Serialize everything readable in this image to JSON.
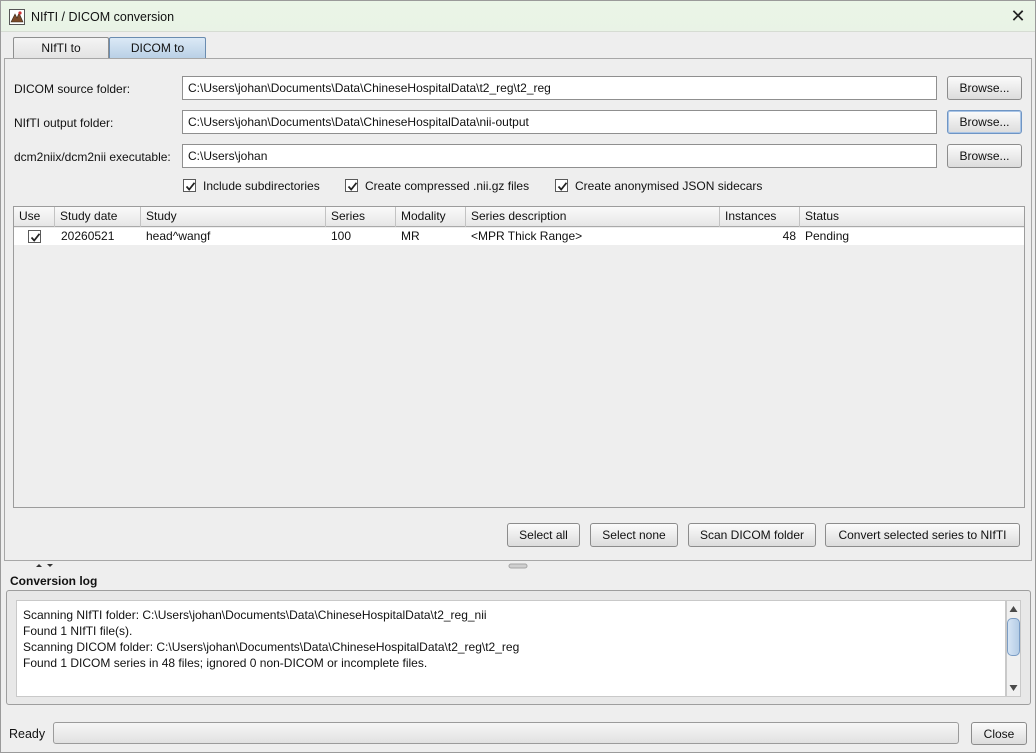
{
  "window": {
    "title": "NIfTI / DICOM conversion",
    "app_icon": "app-logo-icon",
    "close_glyph": "✕"
  },
  "tabs": [
    {
      "label": "NIfTI to DICOM",
      "selected": false
    },
    {
      "label": "DICOM to NIfTI",
      "selected": true
    }
  ],
  "form": {
    "source_label": "DICOM source folder:",
    "source_value": "C:\\Users\\johan\\Documents\\Data\\ChineseHospitalData\\t2_reg\\t2_reg",
    "output_label": "NIfTI output folder:",
    "output_value": "C:\\Users\\johan\\Documents\\Data\\ChineseHospitalData\\nii-output",
    "exe_label": "dcm2niix/dcm2nii executable:",
    "exe_value": "C:\\Users\\johan",
    "browse_label": "Browse..."
  },
  "options": [
    {
      "label": "Include subdirectories",
      "checked": true
    },
    {
      "label": "Create compressed .nii.gz files",
      "checked": true
    },
    {
      "label": "Create anonymised JSON sidecars",
      "checked": true
    }
  ],
  "table": {
    "columns": [
      "Use",
      "Study date",
      "Study",
      "Series",
      "Modality",
      "Series description",
      "Instances",
      "Status"
    ],
    "rows": [
      {
        "use": true,
        "study_date": "20260521",
        "study": "head^wangf",
        "series": "100",
        "modality": "MR",
        "description": "<MPR Thick Range>",
        "instances": "48",
        "status": "Pending"
      }
    ]
  },
  "actions": {
    "select_all": "Select all",
    "select_none": "Select none",
    "scan": "Scan DICOM folder",
    "convert": "Convert selected series to NIfTI"
  },
  "log": {
    "title": "Conversion log",
    "lines": [
      "Scanning NIfTI folder: C:\\Users\\johan\\Documents\\Data\\ChineseHospitalData\\t2_reg_nii",
      "Found 1 NIfTI file(s).",
      "Scanning DICOM folder: C:\\Users\\johan\\Documents\\Data\\ChineseHospitalData\\t2_reg\\t2_reg",
      "Found 1 DICOM series in 48 files; ignored 0 non-DICOM or incomplete files."
    ]
  },
  "status": {
    "text": "Ready",
    "progress": 0,
    "close_label": "Close"
  }
}
